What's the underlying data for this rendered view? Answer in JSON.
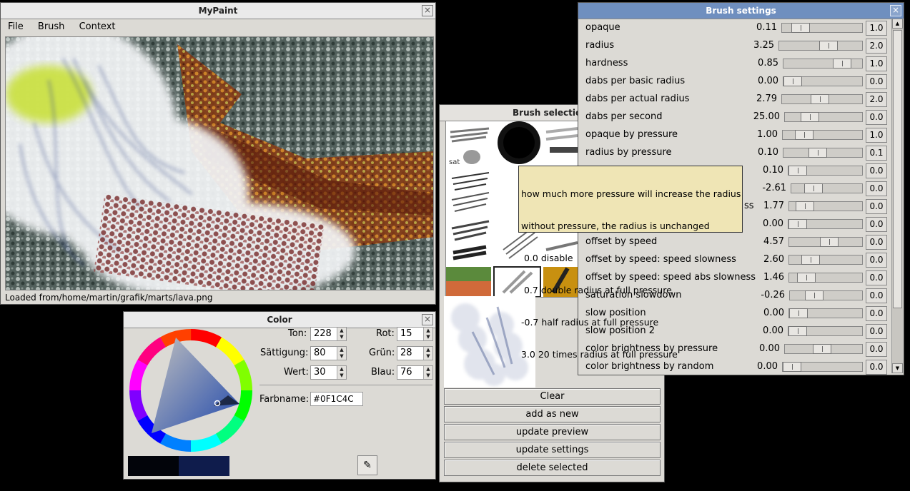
{
  "mypaint": {
    "title": "MyPaint",
    "close_glyph": "×",
    "menu": [
      "File",
      "Brush",
      "Context"
    ],
    "status": "Loaded from/home/martin/grafik/marts/lava.png"
  },
  "color": {
    "title": "Color",
    "close_glyph": "×",
    "ton_label": "Ton:",
    "ton_value": "228",
    "saett_label": "Sättigung:",
    "saett_value": "80",
    "wert_label": "Wert:",
    "wert_value": "30",
    "rot_label": "Rot:",
    "rot_value": "15",
    "gruen_label": "Grün:",
    "gruen_value": "28",
    "blau_label": "Blau:",
    "blau_value": "76",
    "farbname_label": "Farbname:",
    "farbname_value": "#0F1C4C",
    "picker_glyph": "✎",
    "swatch_old": "#02040a",
    "swatch_new": "#0f1c4c"
  },
  "brush_selection": {
    "title": "Brush selection",
    "buttons": [
      "Clear",
      "add as new",
      "update preview",
      "update settings",
      "delete selected"
    ]
  },
  "brush_settings": {
    "title": "Brush settings",
    "close_glyph": "×",
    "rows": [
      {
        "label": "opaque",
        "value": "0.11",
        "level": 0.15,
        "reset": "1.0"
      },
      {
        "label": "radius",
        "value": "3.25",
        "level": 0.62,
        "reset": "2.0"
      },
      {
        "label": "hardness",
        "value": "0.85",
        "level": 0.82,
        "reset": "1.0"
      },
      {
        "label": "dabs per basic radius",
        "value": "0.00",
        "level": 0.0,
        "reset": "0.0"
      },
      {
        "label": "dabs per actual radius",
        "value": "2.79",
        "level": 0.46,
        "reset": "2.0"
      },
      {
        "label": "dabs per second",
        "value": "25.00",
        "level": 0.27,
        "reset": "0.0"
      },
      {
        "label": "opaque by pressure",
        "value": "1.00",
        "level": 0.2,
        "reset": "1.0"
      },
      {
        "label": "radius by pressure",
        "value": "0.10",
        "level": 0.42,
        "reset": "0.1"
      },
      {
        "label": "",
        "value": "0.10",
        "level": 0.0,
        "reset": "0.0"
      },
      {
        "label": "",
        "value": "-2.61",
        "level": 0.24,
        "reset": "0.0"
      },
      {
        "label": "ss",
        "value": "1.77",
        "level": 0.12,
        "reset": "0.0"
      },
      {
        "label": "",
        "value": "0.00",
        "level": 0.0,
        "reset": "0.0"
      },
      {
        "label": "offset by speed",
        "value": "4.57",
        "level": 0.56,
        "reset": "0.0"
      },
      {
        "label": "offset by speed: speed slowness",
        "value": "2.60",
        "level": 0.22,
        "reset": "0.0"
      },
      {
        "label": "offset by speed: speed abs slowness",
        "value": "1.46",
        "level": 0.14,
        "reset": "0.0"
      },
      {
        "label": "saturation slowdown",
        "value": "-0.26",
        "level": 0.28,
        "reset": "0.0"
      },
      {
        "label": "slow position",
        "value": "0.00",
        "level": 0.0,
        "reset": "0.0"
      },
      {
        "label": "slow position 2",
        "value": "0.00",
        "level": 0.0,
        "reset": "0.0"
      },
      {
        "label": "color brightness by pressure",
        "value": "0.00",
        "level": 0.48,
        "reset": "0.0"
      },
      {
        "label": "color brightness by random",
        "value": "0.00",
        "level": 0.0,
        "reset": "0.0"
      }
    ]
  },
  "tooltip": {
    "lines": [
      "how much more pressure will increase the radius",
      "without pressure, the radius is unchanged",
      " 0.0 disable",
      " 0.7 double radius at full pressure",
      "-0.7 half radius at full pressure",
      "3.0 20 times radius at full pressure"
    ]
  }
}
